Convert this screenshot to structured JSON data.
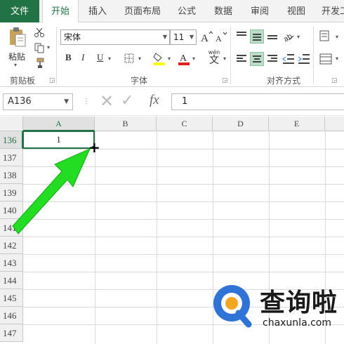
{
  "ribbon": {
    "tabs": [
      "文件",
      "开始",
      "插入",
      "页面布局",
      "公式",
      "数据",
      "审阅",
      "视图",
      "开发工"
    ],
    "active_tab": "开始",
    "clipboard": {
      "paste_label": "粘贴",
      "group_label": "剪贴板"
    },
    "font": {
      "font_name": "宋体",
      "font_size": "11",
      "bold": "B",
      "italic": "I",
      "underline": "U",
      "wen": "wén",
      "wen_char": "文",
      "group_label": "字体"
    },
    "alignment": {
      "group_label": "对齐方式"
    },
    "accent_color": "#217346"
  },
  "formula_bar": {
    "name_box": "A136",
    "cancel_symbol": "✕",
    "enter_symbol": "✓",
    "fx_label": "fx",
    "formula_value": "1"
  },
  "sheet": {
    "columns": [
      "A",
      "B",
      "C",
      "D",
      "E"
    ],
    "selected_column": "A",
    "rows": [
      "136",
      "137",
      "138",
      "139",
      "140",
      "141",
      "142",
      "143",
      "144",
      "145",
      "146",
      "147"
    ],
    "selected_row": "136",
    "active_cell": {
      "ref": "A136",
      "value": "1"
    },
    "cursor": "+"
  },
  "annotation": {
    "arrow_color": "#22dd22"
  },
  "watermark": {
    "brand": "查询啦",
    "url": "chaxunla.com",
    "colors": {
      "blue": "#2f73d6",
      "orange": "#f5a623"
    }
  }
}
